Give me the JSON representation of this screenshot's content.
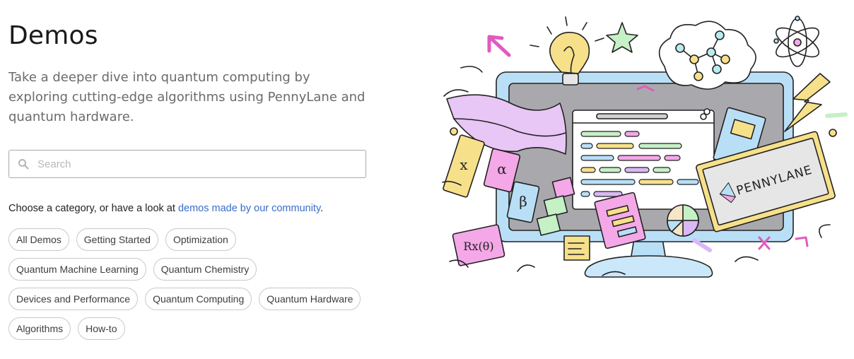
{
  "page": {
    "title": "Demos",
    "subtitle": "Take a deeper dive into quantum computing by exploring cutting-edge algorithms using PennyLane and quantum hardware."
  },
  "search": {
    "placeholder": "Search",
    "value": ""
  },
  "category_prompt": {
    "text": "Choose a category, or have a look at ",
    "link": "demos made by our community",
    "suffix": "."
  },
  "categories": [
    [
      "All Demos",
      "Getting Started",
      "Optimization"
    ],
    [
      "Quantum Machine Learning",
      "Quantum Chemistry"
    ],
    [
      "Devices and Performance",
      "Quantum Computing",
      "Quantum Hardware"
    ],
    [
      "Algorithms",
      "How-to"
    ]
  ],
  "illustration": {
    "brand_text": "PENNYLANE",
    "math_labels": [
      "x",
      "α",
      "β",
      "Rx(θ)"
    ],
    "colors": {
      "monitor": "#b9dff7",
      "screen": "#a9a9ad",
      "accent": "#3a6dc9"
    }
  }
}
